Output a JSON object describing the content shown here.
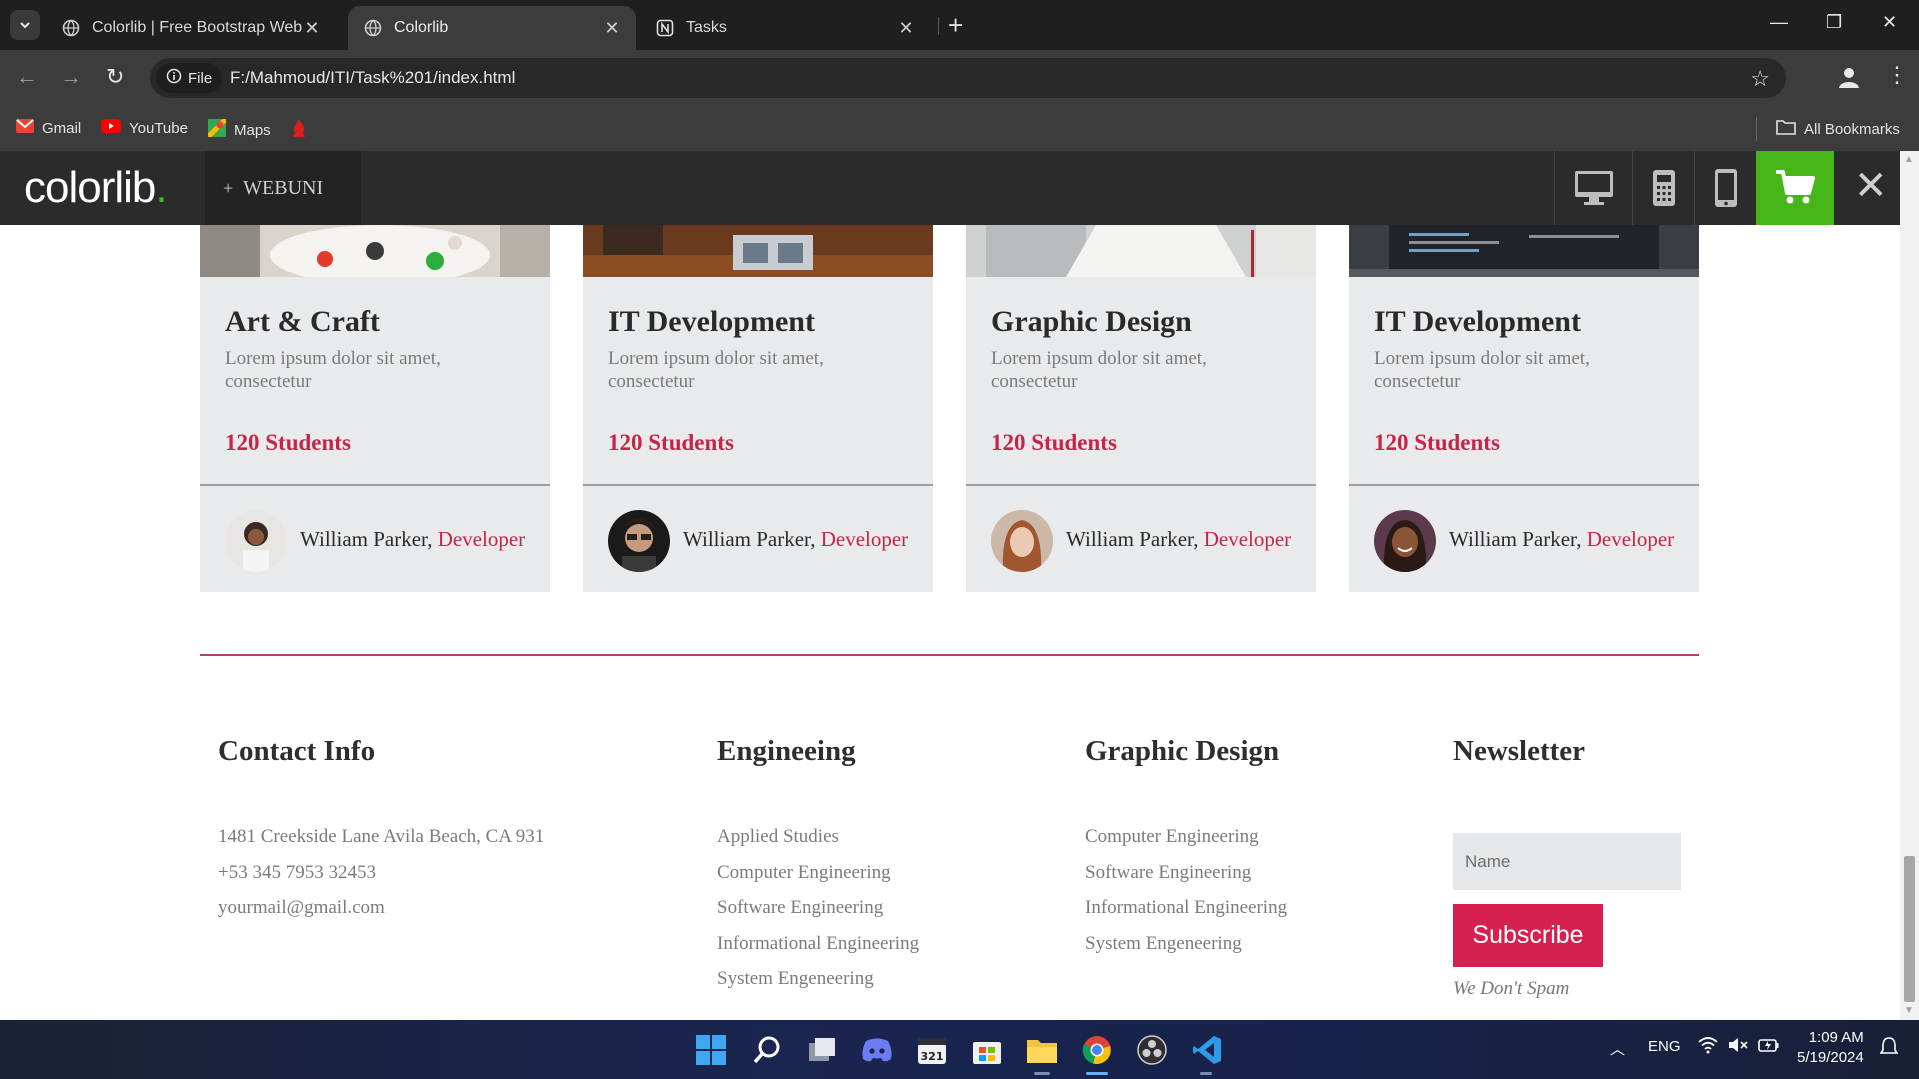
{
  "browser": {
    "tabs": [
      {
        "title": "Colorlib | Free Bootstrap Websit",
        "active": false
      },
      {
        "title": "Colorlib",
        "active": true
      },
      {
        "title": "Tasks",
        "active": false
      }
    ],
    "url_chip": "File",
    "url": "F:/Mahmoud/ITI/Task%201/index.html",
    "bookmarks": [
      "Gmail",
      "YouTube",
      "Maps"
    ],
    "all_bookmarks": "All Bookmarks"
  },
  "colorlib_bar": {
    "logo": "colorlib",
    "logo_dot": ".",
    "theme_name": "WEBUNI",
    "accent": "#46b518"
  },
  "courses": [
    {
      "title": "Art & Craft",
      "desc": "Lorem ipsum dolor sit amet, consectetur",
      "students": "120 Students",
      "author": "William Parker,",
      "role": "Developer"
    },
    {
      "title": "IT Development",
      "desc": "Lorem ipsum dolor sit amet, consectetur",
      "students": "120 Students",
      "author": "William Parker,",
      "role": "Developer"
    },
    {
      "title": "Graphic Design",
      "desc": "Lorem ipsum dolor sit amet, consectetur",
      "students": "120 Students",
      "author": "William Parker,",
      "role": "Developer"
    },
    {
      "title": "IT Development",
      "desc": "Lorem ipsum dolor sit amet, consectetur",
      "students": "120 Students",
      "author": "William Parker,",
      "role": "Developer"
    }
  ],
  "footer": {
    "contact": {
      "title": "Contact Info",
      "items": [
        "1481 Creekside Lane Avila Beach, CA 931",
        "+53 345 7953 32453",
        "yourmail@gmail.com"
      ]
    },
    "engineering": {
      "title": "Engineeing",
      "items": [
        "Applied Studies",
        "Computer Engineering",
        "Software Engineering",
        "Informational Engineering",
        "System Engeneering"
      ]
    },
    "graphic": {
      "title": "Graphic Design",
      "items": [
        "Computer Engineering",
        "Software Engineering",
        "Informational Engineering",
        "System Engeneering"
      ]
    },
    "newsletter": {
      "title": "Newsletter",
      "placeholder": "Name",
      "button": "Subscribe",
      "note": "We Don't Spam"
    }
  },
  "colors": {
    "accent_red": "#c62549",
    "button_red": "#d6204f"
  },
  "taskbar": {
    "lang": "ENG",
    "time": "1:09 AM",
    "date": "5/19/2024",
    "calendar_badge": "321"
  }
}
